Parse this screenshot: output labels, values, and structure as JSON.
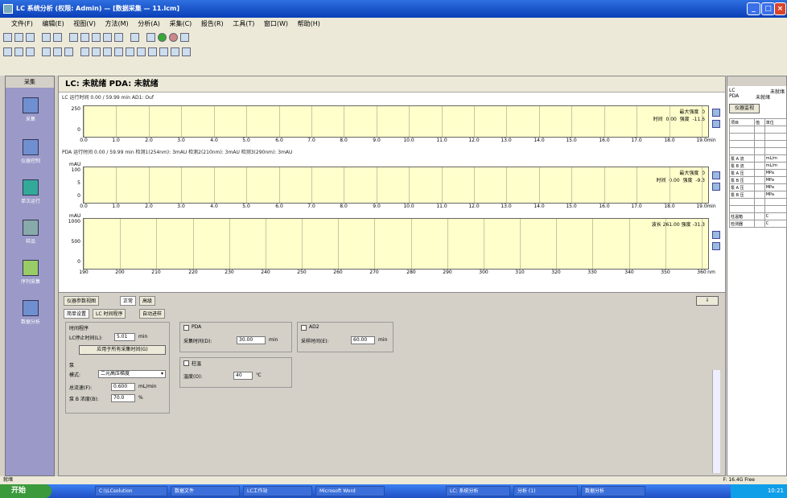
{
  "window": {
    "title": "LC 系统分析 (权限: Admin) — [数据采集 — 11.lcm]"
  },
  "menu": [
    "文件(F)",
    "编辑(E)",
    "视图(V)",
    "方法(M)",
    "分析(A)",
    "采集(C)",
    "报告(R)",
    "工具(T)",
    "窗口(W)",
    "帮助(H)"
  ],
  "sidebar": {
    "header": "采集",
    "items": [
      "采集",
      "仪器控制",
      "单次运行",
      "样品",
      "序列采集",
      "数据分析"
    ]
  },
  "main": {
    "title": "LC: 未就绪  PDA: 未就绪",
    "lc_status": "LC 运行时间  0.00 / 59.99 min  AD1: Ouf",
    "pda_status": "PDA 运行时间  0.00 / 59.99 min  检测1(254nm): 3mAU  检测2(210nm): 3mAU  检测3(290nm): 3mAU",
    "charts": [
      {
        "info": "最大强度  0\n时间  0.00  强度  -11.6",
        "yticks": [
          "250",
          "0"
        ],
        "xticks": [
          "0.0",
          "1.0",
          "2.0",
          "3.0",
          "4.0",
          "5.0",
          "6.0",
          "7.0",
          "8.0",
          "9.0",
          "10.0",
          "11.0",
          "12.0",
          "13.0",
          "14.0",
          "15.0",
          "16.0",
          "17.0",
          "18.0",
          "19.0"
        ],
        "xunit": "min"
      },
      {
        "info": "最大强度  0\n时间  0.00  强度  -9.3",
        "yunit": "mAU",
        "yticks": [
          "100",
          "5",
          "0"
        ],
        "xticks": [
          "0.0",
          "1.0",
          "2.0",
          "3.0",
          "4.0",
          "5.0",
          "6.0",
          "7.0",
          "8.0",
          "9.0",
          "10.0",
          "11.0",
          "12.0",
          "13.0",
          "14.0",
          "15.0",
          "16.0",
          "17.0",
          "18.0",
          "19.0"
        ],
        "xunit": "min"
      },
      {
        "info": "波长  261.00  强度  -31.3",
        "yunit": "mAU",
        "yticks": [
          "1000",
          "500",
          "0"
        ],
        "xticks": [
          "190",
          "200",
          "210",
          "220",
          "230",
          "240",
          "250",
          "260",
          "270",
          "280",
          "290",
          "300",
          "310",
          "320",
          "330",
          "340",
          "350",
          "360"
        ],
        "xunit": "nm"
      }
    ]
  },
  "params": {
    "tabs": [
      "仪器参数视图",
      "正常",
      "高级"
    ],
    "subtabs": [
      "简单设置",
      "LC 时间程序",
      "自动进样"
    ],
    "time_prog": {
      "title": "时间程序",
      "stop_label": "LC停止时间(L):",
      "stop_value": "5.01",
      "stop_unit": "min",
      "button": "应用于所有采集时间(G)"
    },
    "pump": {
      "title": "泵",
      "mode_label": "模式:",
      "mode_value": "二元高压梯度",
      "flow_label": "总流速(F):",
      "flow_value": "0.600",
      "flow_unit": "mL/min",
      "conc_label": "泵 B 浓度(B):",
      "conc_value": "70.0",
      "conc_unit": "%"
    },
    "pda": {
      "title": "PDA",
      "label": "采集时间(D):",
      "value": "30.00",
      "unit": "min"
    },
    "ad": {
      "title": "AD2",
      "label": "采样时间(E):",
      "value": "60.00",
      "unit": "min"
    },
    "oven": {
      "title": "柱温",
      "label": "温度(O):",
      "value": "40",
      "unit": "℃"
    }
  },
  "right_panel": {
    "labels": [
      "LC",
      "PDA"
    ],
    "values": [
      "未就绪",
      "未就绪"
    ],
    "button": "仪器监视",
    "headers": [
      "项目",
      "值",
      "单位"
    ],
    "rows": [
      [
        "",
        "",
        ""
      ],
      [
        "",
        "",
        ""
      ],
      [
        "",
        "",
        ""
      ],
      [
        "",
        "",
        ""
      ],
      [
        "泵 A 流",
        "",
        "mL/m"
      ],
      [
        "泵 B 流",
        "",
        "mL/m"
      ],
      [
        "泵 A 压",
        "",
        "MPa"
      ],
      [
        "泵 B 压",
        "",
        "MPa"
      ],
      [
        "泵 A 压",
        "",
        "MPa"
      ],
      [
        "泵 B 压",
        "",
        "MPa"
      ],
      [
        "",
        "",
        ""
      ],
      [
        "",
        "",
        ""
      ],
      [
        "柱温箱",
        "",
        "C"
      ],
      [
        "检测器",
        "",
        "C"
      ]
    ]
  },
  "statusbar": {
    "left": "就绪",
    "right": "F:  16.4G Free"
  },
  "taskbar": {
    "start": "开始",
    "tasks": [
      "C:\\\\LCsolution",
      "数据文件",
      "LC工作站",
      "Microsoft Word",
      "LC: 系统分析",
      "分析 (1)",
      "数据分析"
    ],
    "clock": "10:21"
  }
}
